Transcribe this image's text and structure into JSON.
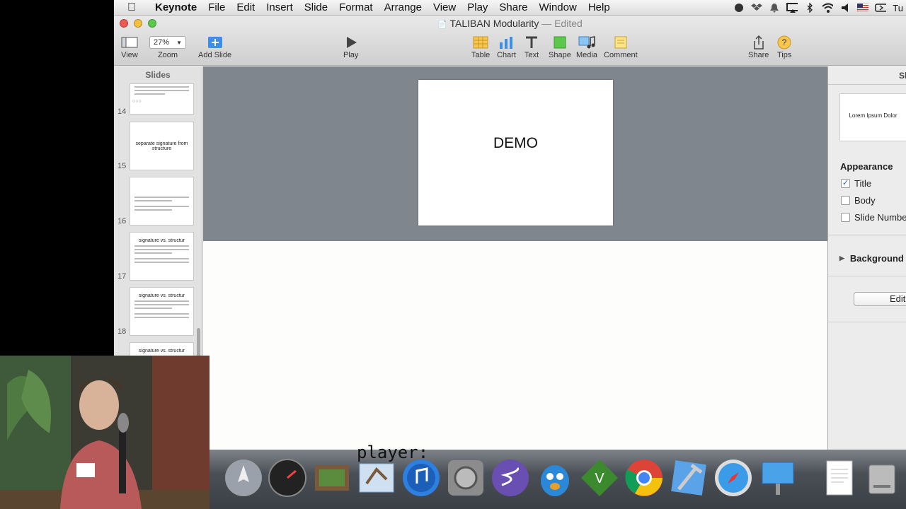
{
  "menubar": {
    "app": "Keynote",
    "items": [
      "File",
      "Edit",
      "Insert",
      "Slide",
      "Format",
      "Arrange",
      "View",
      "Play",
      "Share",
      "Window",
      "Help"
    ],
    "status_text": "Tu"
  },
  "window": {
    "title": "TALIBAN Modularity",
    "edited": "— Edited"
  },
  "toolbar": {
    "view": "View",
    "zoom_value": "27%",
    "zoom": "Zoom",
    "add_slide": "Add Slide",
    "play": "Play",
    "table": "Table",
    "chart": "Chart",
    "text": "Text",
    "shape": "Shape",
    "media": "Media",
    "comment": "Comment",
    "share": "Share",
    "tips": "Tips"
  },
  "sidebar": {
    "header": "Slides",
    "slides": [
      {
        "num": "14",
        "title": ""
      },
      {
        "num": "15",
        "title": "separate signature from structure"
      },
      {
        "num": "16",
        "title": ""
      },
      {
        "num": "17",
        "title": "signature vs. structur"
      },
      {
        "num": "18",
        "title": "signature vs. structur"
      },
      {
        "num": "",
        "title": "signature vs. structur"
      }
    ]
  },
  "canvas": {
    "slide_text": "DEMO"
  },
  "inspector": {
    "header": "Sli",
    "layout_text": "Lorem Ipsum Dolor",
    "appearance": "Appearance",
    "title_opt": "Title",
    "body_opt": "Body",
    "slide_number_opt": "Slide Numbe",
    "background": "Background",
    "edit": "Edit"
  },
  "dock": {
    "overlay_text": "player:",
    "icons": [
      "launchpad-icon",
      "dashboard-icon",
      "image-capture-icon",
      "mail-icon",
      "itunes-icon",
      "system-preferences-icon",
      "emacs-icon",
      "tweetbot-icon",
      "vim-icon",
      "chrome-icon",
      "xcode-icon",
      "safari-icon",
      "keynote-icon",
      "document-icon",
      "disk-icon"
    ]
  },
  "colors": {
    "canvas_bg": "#7f868e",
    "accent": "#1a5bd6"
  }
}
